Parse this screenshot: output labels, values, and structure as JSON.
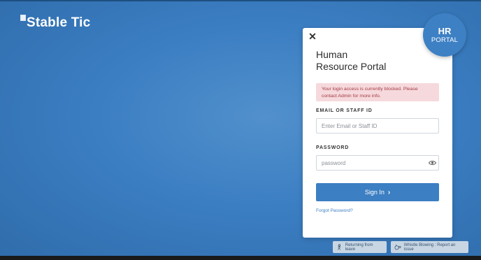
{
  "brand": {
    "name": "Stable Tic"
  },
  "badge": {
    "line1": "HR",
    "line2": "PORTAL"
  },
  "login": {
    "title_line1": "Human",
    "title_line2": "Resource Portal",
    "alert": "Your login access is currently blocked. Please contact Admin for more info.",
    "email_label": "EMAIL OR STAFF ID",
    "email_placeholder": "Enter Email or Staff ID",
    "email_value": "",
    "password_label": "PASSWORD",
    "password_placeholder": "password",
    "password_value": "",
    "signin_label": "Sign In",
    "forgot_label": "Forgot Password?",
    "close_glyph": "✕"
  },
  "footer": {
    "returning_label": "Returning from leave",
    "whistle_label": "Whistle Blowing : Report an issue"
  },
  "colors": {
    "background": "#3b7ec2",
    "primary": "#3c7fc3",
    "alert_bg": "#f6d9dc",
    "alert_text": "#a23a44"
  }
}
